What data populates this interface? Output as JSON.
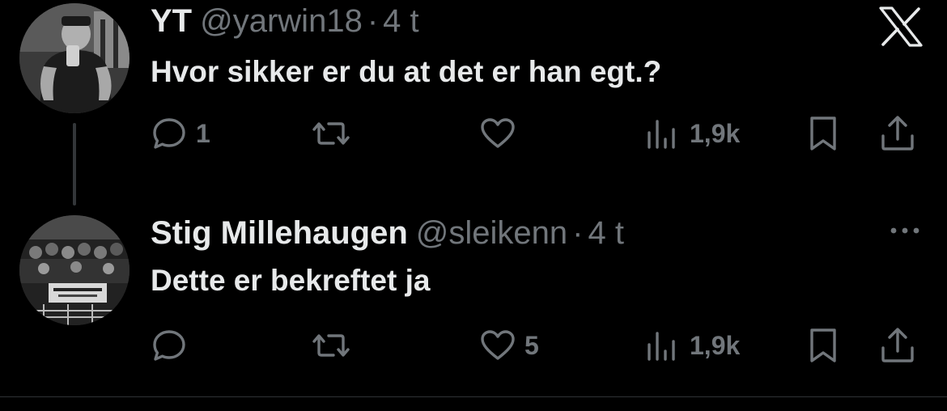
{
  "tweets": [
    {
      "display_name": "YT",
      "handle": "@yarwin18",
      "separator": "·",
      "time": "4 t",
      "text": "Hvor sikker er du at det er han egt.?",
      "replies": "1",
      "retweets": "",
      "likes": "",
      "views": "1,9k",
      "avatar_icon": "gym-selfie-avatar"
    },
    {
      "display_name": "Stig Millehaugen",
      "handle": "@sleikenn",
      "separator": "·",
      "time": "4 t",
      "text": "Dette er bekreftet ja",
      "replies": "",
      "retweets": "",
      "likes": "5",
      "views": "1,9k",
      "avatar_icon": "crowd-banner-avatar"
    }
  ],
  "icons": {
    "close": "x-logo-icon",
    "more": "more-dots-icon",
    "reply": "reply-icon",
    "retweet": "retweet-icon",
    "like": "heart-icon",
    "views": "views-icon",
    "bookmark": "bookmark-icon",
    "share": "share-icon"
  },
  "colors": {
    "background": "#000000",
    "primary_text": "#e7e9ea",
    "secondary_text": "#71767b",
    "thread_line": "#333639"
  }
}
